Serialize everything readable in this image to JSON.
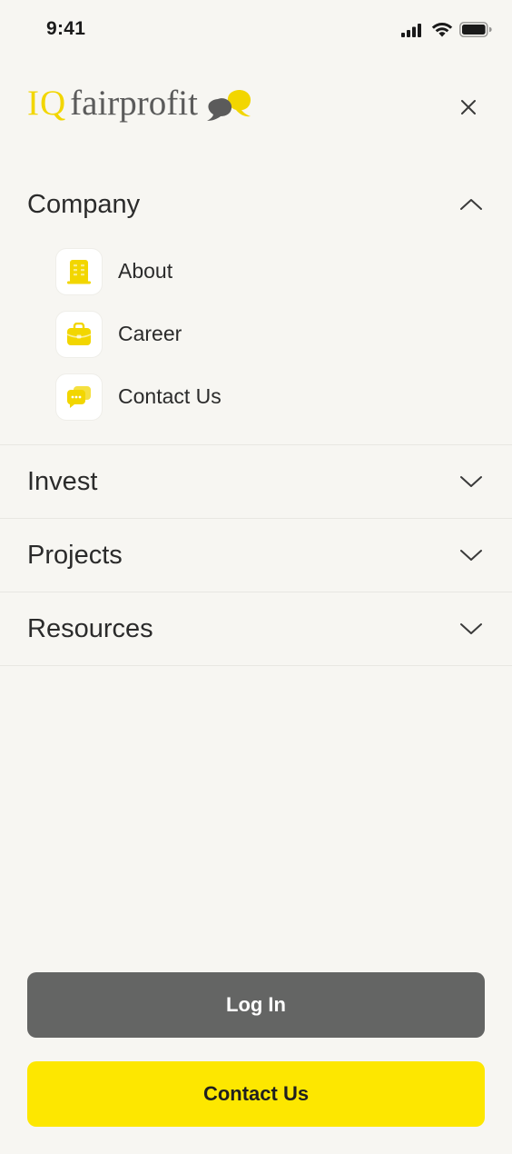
{
  "status_bar": {
    "time": "9:41",
    "icons": [
      "signal-icon",
      "wifi-icon",
      "battery-icon"
    ]
  },
  "header": {
    "logo_iq": "IQ",
    "logo_name": "fairprofit",
    "close_icon": "close-icon"
  },
  "nav": {
    "sections": [
      {
        "title": "Company",
        "expanded": true,
        "items": [
          {
            "label": "About",
            "icon": "building-icon"
          },
          {
            "label": "Career",
            "icon": "briefcase-icon"
          },
          {
            "label": "Contact Us",
            "icon": "chat-bubbles-icon"
          }
        ]
      },
      {
        "title": "Invest",
        "expanded": false
      },
      {
        "title": "Projects",
        "expanded": false
      },
      {
        "title": "Resources",
        "expanded": false
      }
    ]
  },
  "actions": {
    "login_label": "Log In",
    "contact_label": "Contact Us"
  },
  "colors": {
    "background": "#f7f6f2",
    "accent_yellow": "#fde700",
    "login_gray": "#646564",
    "text": "#2b2b2b"
  }
}
